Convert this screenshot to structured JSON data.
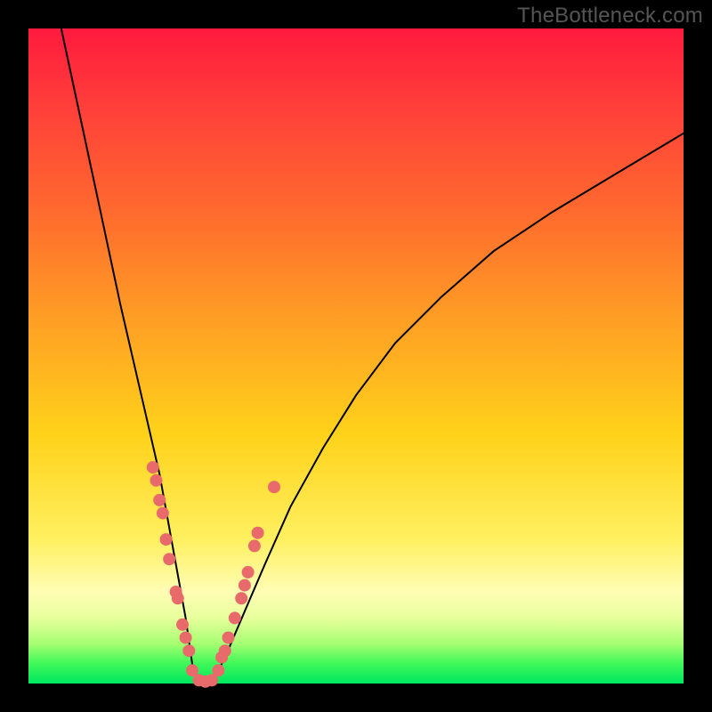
{
  "watermark": "TheBottleneck.com",
  "colors": {
    "frame": "#000000",
    "gradient_top": "#ff1a3e",
    "gradient_mid_orange": "#ff6a2e",
    "gradient_mid_yellow": "#ffd21a",
    "gradient_pale": "#fffdb5",
    "gradient_bottom": "#00e860",
    "curve": "#000000",
    "dot": "#e86a6a"
  },
  "chart_data": {
    "type": "line",
    "title": "",
    "xlabel": "",
    "ylabel": "",
    "x_range": [
      0,
      100
    ],
    "y_range": [
      0,
      100
    ],
    "note": "A V-shaped bottleneck curve. The left branch falls steeply from near y=100 at x≈5 to y≈0 at x≈25. The right branch rises with a concave shape from y≈0 at x≈30 to roughly y≈84 at x=100. Scattered salmon dots cluster along both branches near the bottom (roughly y between 0 and 33). Axes are unlabeled; values are read from relative pixel positions normalised to 0–100.",
    "series": [
      {
        "name": "left_branch",
        "x": [
          5,
          8,
          11,
          14,
          17,
          20,
          22,
          24,
          25,
          26
        ],
        "y": [
          100,
          86,
          72,
          58,
          45,
          32,
          21,
          10,
          3,
          0
        ]
      },
      {
        "name": "right_branch",
        "x": [
          28,
          30,
          33,
          36,
          40,
          45,
          50,
          56,
          63,
          71,
          80,
          90,
          100
        ],
        "y": [
          0,
          4,
          11,
          18,
          27,
          36,
          44,
          52,
          59,
          66,
          72,
          78,
          84
        ]
      }
    ],
    "scatter": [
      {
        "x": 19.0,
        "y": 33
      },
      {
        "x": 19.5,
        "y": 31
      },
      {
        "x": 20.0,
        "y": 28
      },
      {
        "x": 20.5,
        "y": 26
      },
      {
        "x": 21.0,
        "y": 22
      },
      {
        "x": 21.5,
        "y": 19
      },
      {
        "x": 22.5,
        "y": 14
      },
      {
        "x": 22.8,
        "y": 13
      },
      {
        "x": 23.5,
        "y": 9
      },
      {
        "x": 24.0,
        "y": 7
      },
      {
        "x": 24.5,
        "y": 5
      },
      {
        "x": 25.0,
        "y": 2
      },
      {
        "x": 26.0,
        "y": 0.5
      },
      {
        "x": 27.0,
        "y": 0.3
      },
      {
        "x": 28.0,
        "y": 0.5
      },
      {
        "x": 29.0,
        "y": 2
      },
      {
        "x": 29.5,
        "y": 4
      },
      {
        "x": 30.0,
        "y": 5
      },
      {
        "x": 30.5,
        "y": 7
      },
      {
        "x": 31.5,
        "y": 10
      },
      {
        "x": 32.5,
        "y": 13
      },
      {
        "x": 33.0,
        "y": 15
      },
      {
        "x": 33.5,
        "y": 17
      },
      {
        "x": 34.5,
        "y": 21
      },
      {
        "x": 35.0,
        "y": 23
      },
      {
        "x": 37.5,
        "y": 30
      }
    ]
  }
}
